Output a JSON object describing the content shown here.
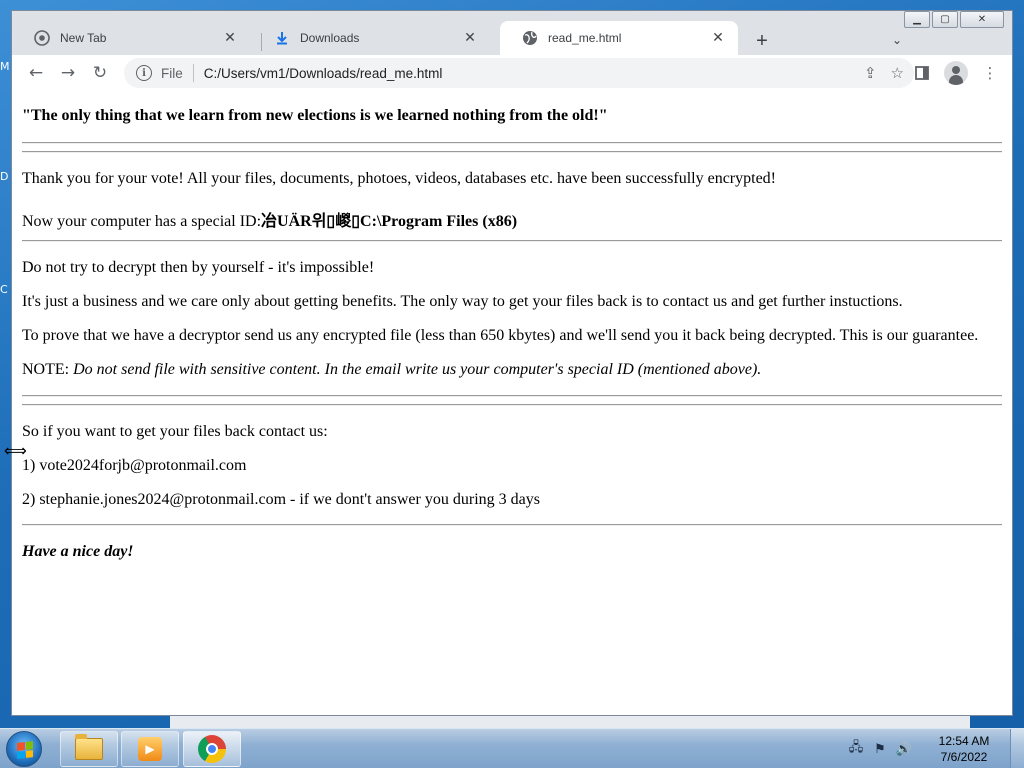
{
  "desktop": {
    "letters": [
      "M",
      "D",
      "C"
    ]
  },
  "browser": {
    "tabs": [
      {
        "label": "New Tab",
        "icon": "chrome-icon",
        "active": false
      },
      {
        "label": "Downloads",
        "icon": "download-icon",
        "active": false
      },
      {
        "label": "read_me.html",
        "icon": "globe-icon",
        "active": true
      }
    ],
    "omnibox": {
      "scheme": "File",
      "url": "C:/Users/vm1/Downloads/read_me.html"
    },
    "window_controls": [
      "minimize",
      "maximize",
      "close"
    ]
  },
  "page": {
    "title_quote": "\"The only thing that we learn from new elections is we learned nothing from the old!\"",
    "thank_you": "Thank you for your vote! All your files, documents, photoes, videos, databases etc. have been successfully encrypted!",
    "special_id_label": "Now your computer has a special ID:",
    "special_id_value": "冶UÄR위▯嵕▯C:\\Program Files (x86)",
    "dont_decrypt": "Do not try to decrypt then by yourself - it's impossible!",
    "business": "It's just a business and we care only about getting benefits. The only way to get your files back is to contact us and get further instuctions.",
    "prove": "To prove that we have a decryptor send us any encrypted file (less than 650 kbytes) and we'll send you it back being decrypted. This is our guarantee.",
    "note_label": "NOTE: ",
    "note_text": "Do not send file with sensitive content. In the email write us your computer's special ID (mentioned above).",
    "contact_intro": "So if you want to get your files back contact us:",
    "contact_1": "1) vote2024forjb@protonmail.com",
    "contact_2": "2) stephanie.jones2024@protonmail.com - if we dont't answer you during 3 days",
    "closing": "Have a nice day!"
  },
  "taskbar": {
    "apps": [
      "windows-explorer",
      "media-player",
      "chrome"
    ],
    "clock": {
      "time": "12:54 AM",
      "date": "7/6/2022"
    }
  }
}
